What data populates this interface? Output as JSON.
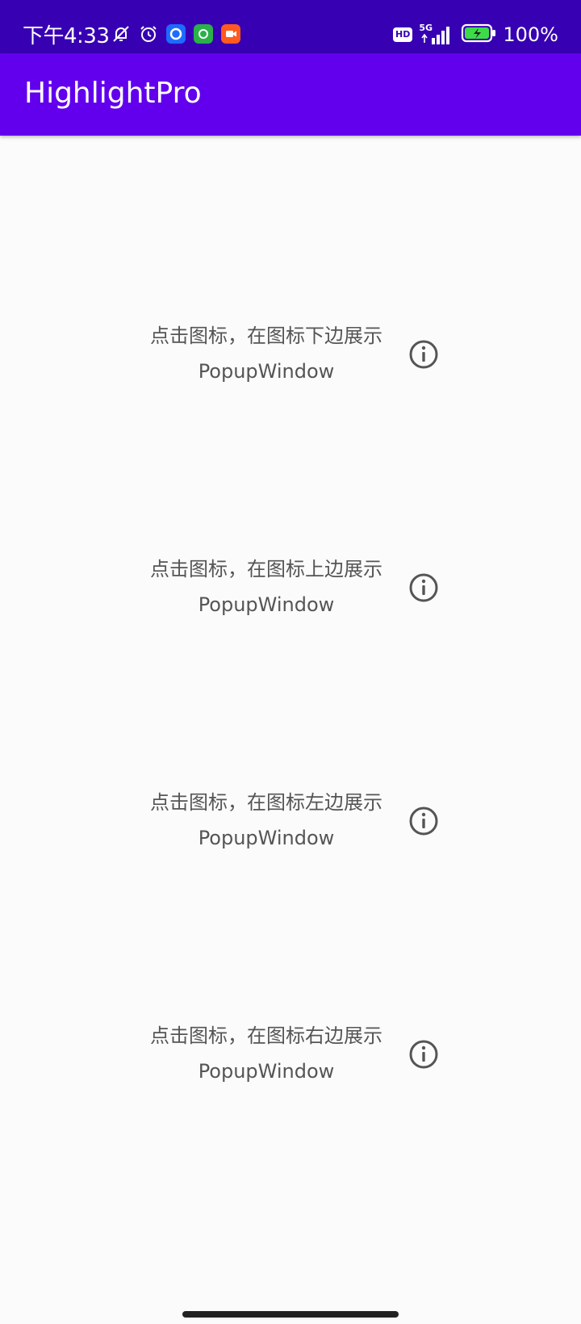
{
  "status_bar": {
    "time": "下午4:33",
    "network": "5G",
    "hd": "HD",
    "battery": "100%",
    "colors": {
      "background": "#3700b3"
    },
    "app_badges": [
      {
        "name": "qq-browser-icon",
        "color": "#1e6bff"
      },
      {
        "name": "wechat-icon",
        "color": "#2bb04a"
      },
      {
        "name": "video-icon",
        "color": "#ff5a1f"
      }
    ]
  },
  "app_bar": {
    "title": "HighlightPro",
    "color": "#6200ee"
  },
  "items": [
    {
      "line1": "点击图标，在图标下边展示",
      "line2": "PopupWindow",
      "icon": "info-icon"
    },
    {
      "line1": "点击图标，在图标上边展示",
      "line2": "PopupWindow",
      "icon": "info-icon"
    },
    {
      "line1": "点击图标，在图标左边展示",
      "line2": "PopupWindow",
      "icon": "info-icon"
    },
    {
      "line1": "点击图标，在图标右边展示",
      "line2": "PopupWindow",
      "icon": "info-icon"
    }
  ]
}
